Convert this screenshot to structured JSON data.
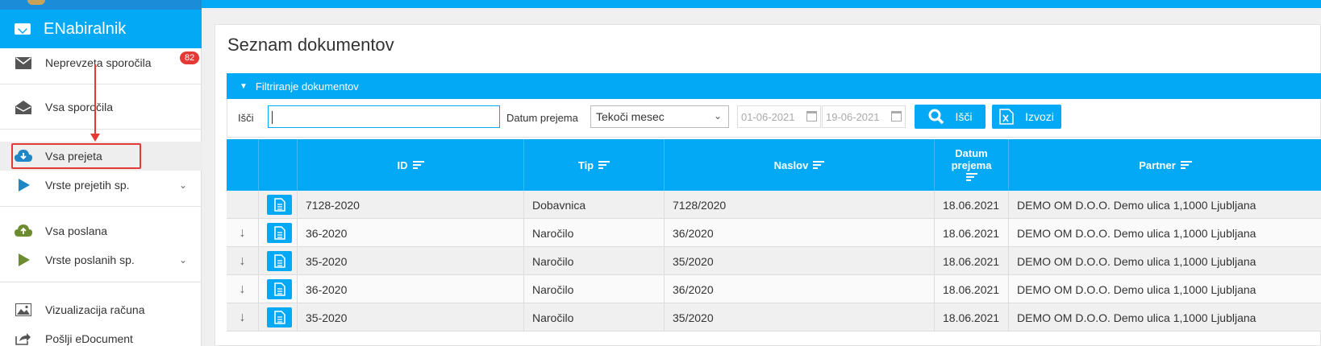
{
  "sidebar": {
    "app_name": "ENabiralnik",
    "unread_badge": "82",
    "items": [
      {
        "label": "Neprevzeta sporočila"
      },
      {
        "label": "Vsa sporočila"
      },
      {
        "label": "Vsa prejeta"
      },
      {
        "label": "Vrste prejetih sp."
      },
      {
        "label": "Vsa poslana"
      },
      {
        "label": "Vrste poslanih sp."
      },
      {
        "label": "Vizualizacija računa"
      },
      {
        "label": "Pošlji eDocument"
      }
    ]
  },
  "main": {
    "title": "Seznam dokumentov",
    "filter": {
      "section_label": "Filtriranje dokumentov",
      "search_label": "Išči",
      "search_value": "",
      "date_label": "Datum prejema",
      "period_value": "Tekoči mesec",
      "date_from": "01-06-2021",
      "date_to": "19-06-2021",
      "search_button": "Išči",
      "export_button": "Izvozi"
    },
    "table": {
      "columns": [
        "ID",
        "Tip",
        "Naslov",
        "Datum prejema",
        "Partner"
      ],
      "rows": [
        {
          "id": "7128-2020",
          "tip": "Dobavnica",
          "naslov": "7128/2020",
          "datum": "18.06.2021",
          "partner": "DEMO OM D.O.O. Demo ulica 1,1000 Ljubljana"
        },
        {
          "id": "36-2020",
          "tip": "Naročilo",
          "naslov": "36/2020",
          "datum": "18.06.2021",
          "partner": "DEMO OM D.O.O. Demo ulica 1,1000 Ljubljana"
        },
        {
          "id": "35-2020",
          "tip": "Naročilo",
          "naslov": "35/2020",
          "datum": "18.06.2021",
          "partner": "DEMO OM D.O.O. Demo ulica 1,1000 Ljubljana"
        },
        {
          "id": "36-2020",
          "tip": "Naročilo",
          "naslov": "36/2020",
          "datum": "18.06.2021",
          "partner": "DEMO OM D.O.O. Demo ulica 1,1000 Ljubljana"
        },
        {
          "id": "35-2020",
          "tip": "Naročilo",
          "naslov": "35/2020",
          "datum": "18.06.2021",
          "partner": "DEMO OM D.O.O. Demo ulica 1,1000 Ljubljana"
        }
      ]
    }
  },
  "colors": {
    "accent": "#03a9f4",
    "highlight": "#e53935"
  }
}
